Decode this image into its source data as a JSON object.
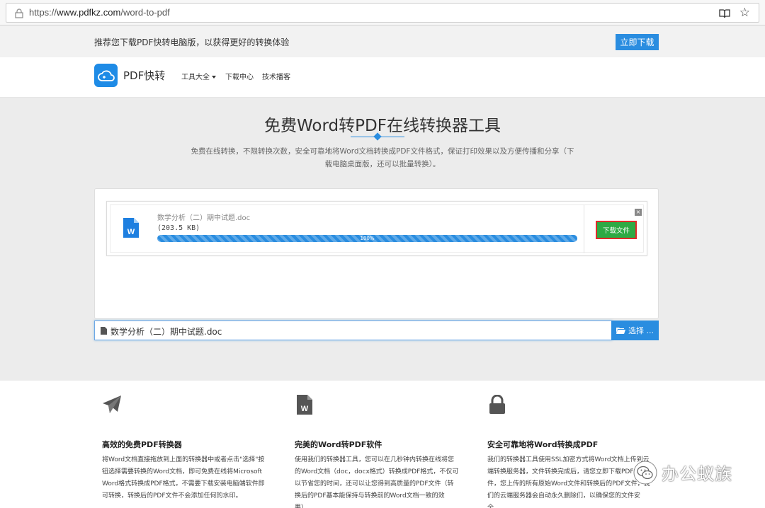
{
  "browser": {
    "url_prefix": "https://",
    "url_domain": "www.pdfkz.com",
    "url_path": "/word-to-pdf"
  },
  "promo": {
    "text": "推荐您下载PDF快转电脑版，以获得更好的转换体验",
    "button": "立即下载"
  },
  "nav": {
    "logo": "PDF快转",
    "items": [
      "工具大全",
      "下载中心",
      "技术播客"
    ]
  },
  "hero": {
    "title": "免费Word转PDF在线转换器工具",
    "description": "免费在线转换，不限转换次数，安全可靠地将Word文档转换成PDF文件格式，保证打印效果以及方便传播和分享（下载电脑桌面版，还可以批量转换）。"
  },
  "converter": {
    "file_name": "数学分析（二）期中试题.doc",
    "file_size": "(203.5 KB)",
    "progress": 1.0,
    "progress_label": "100%",
    "download_button": "下载文件",
    "close_symbol": "×",
    "input_value": "数学分析（二）期中试题.doc",
    "select_button": "选择 ..."
  },
  "features": [
    {
      "icon": "paper-plane-icon",
      "title": "高效的免费PDF转换器",
      "desc": "将Word文档直接拖放到上面的转换器中或者点击\"选择\"按钮选择需要转换的Word文档，即可免费在线将Microsoft Word格式转换成PDF格式，不需要下载安装电脑端软件即可转换，转换后的PDF文件不会添加任何的水印。"
    },
    {
      "icon": "word-file-icon",
      "title": "完美的Word转PDF软件",
      "desc": "使用我们的转换器工具，您可以在几秒钟内转换在线将您的Word文档（doc，docx格式）转换成PDF格式，不仅可以节省您的时间，还可以让您得到高质量的PDF文件（转换后的PDF基本能保持与转换前的Word文档一致的效果）。"
    },
    {
      "icon": "lock-icon",
      "title": "安全可靠地将Word转换成PDF",
      "desc": "我们的转换器工具使用SSL加密方式将Word文档上传到云端转换服务器，文件转换完成后，请您立即下载PDF文件，您上传的所有原始Word文件和转换后的PDF文件，我们的云端服务器会自动永久删除们，以确保您的文件安全。"
    }
  ],
  "watermark": {
    "text": "办公蚁族"
  },
  "colors": {
    "accent": "#2a8de0",
    "download_green": "#2eaa44",
    "highlight_red": "#e02a2a"
  }
}
